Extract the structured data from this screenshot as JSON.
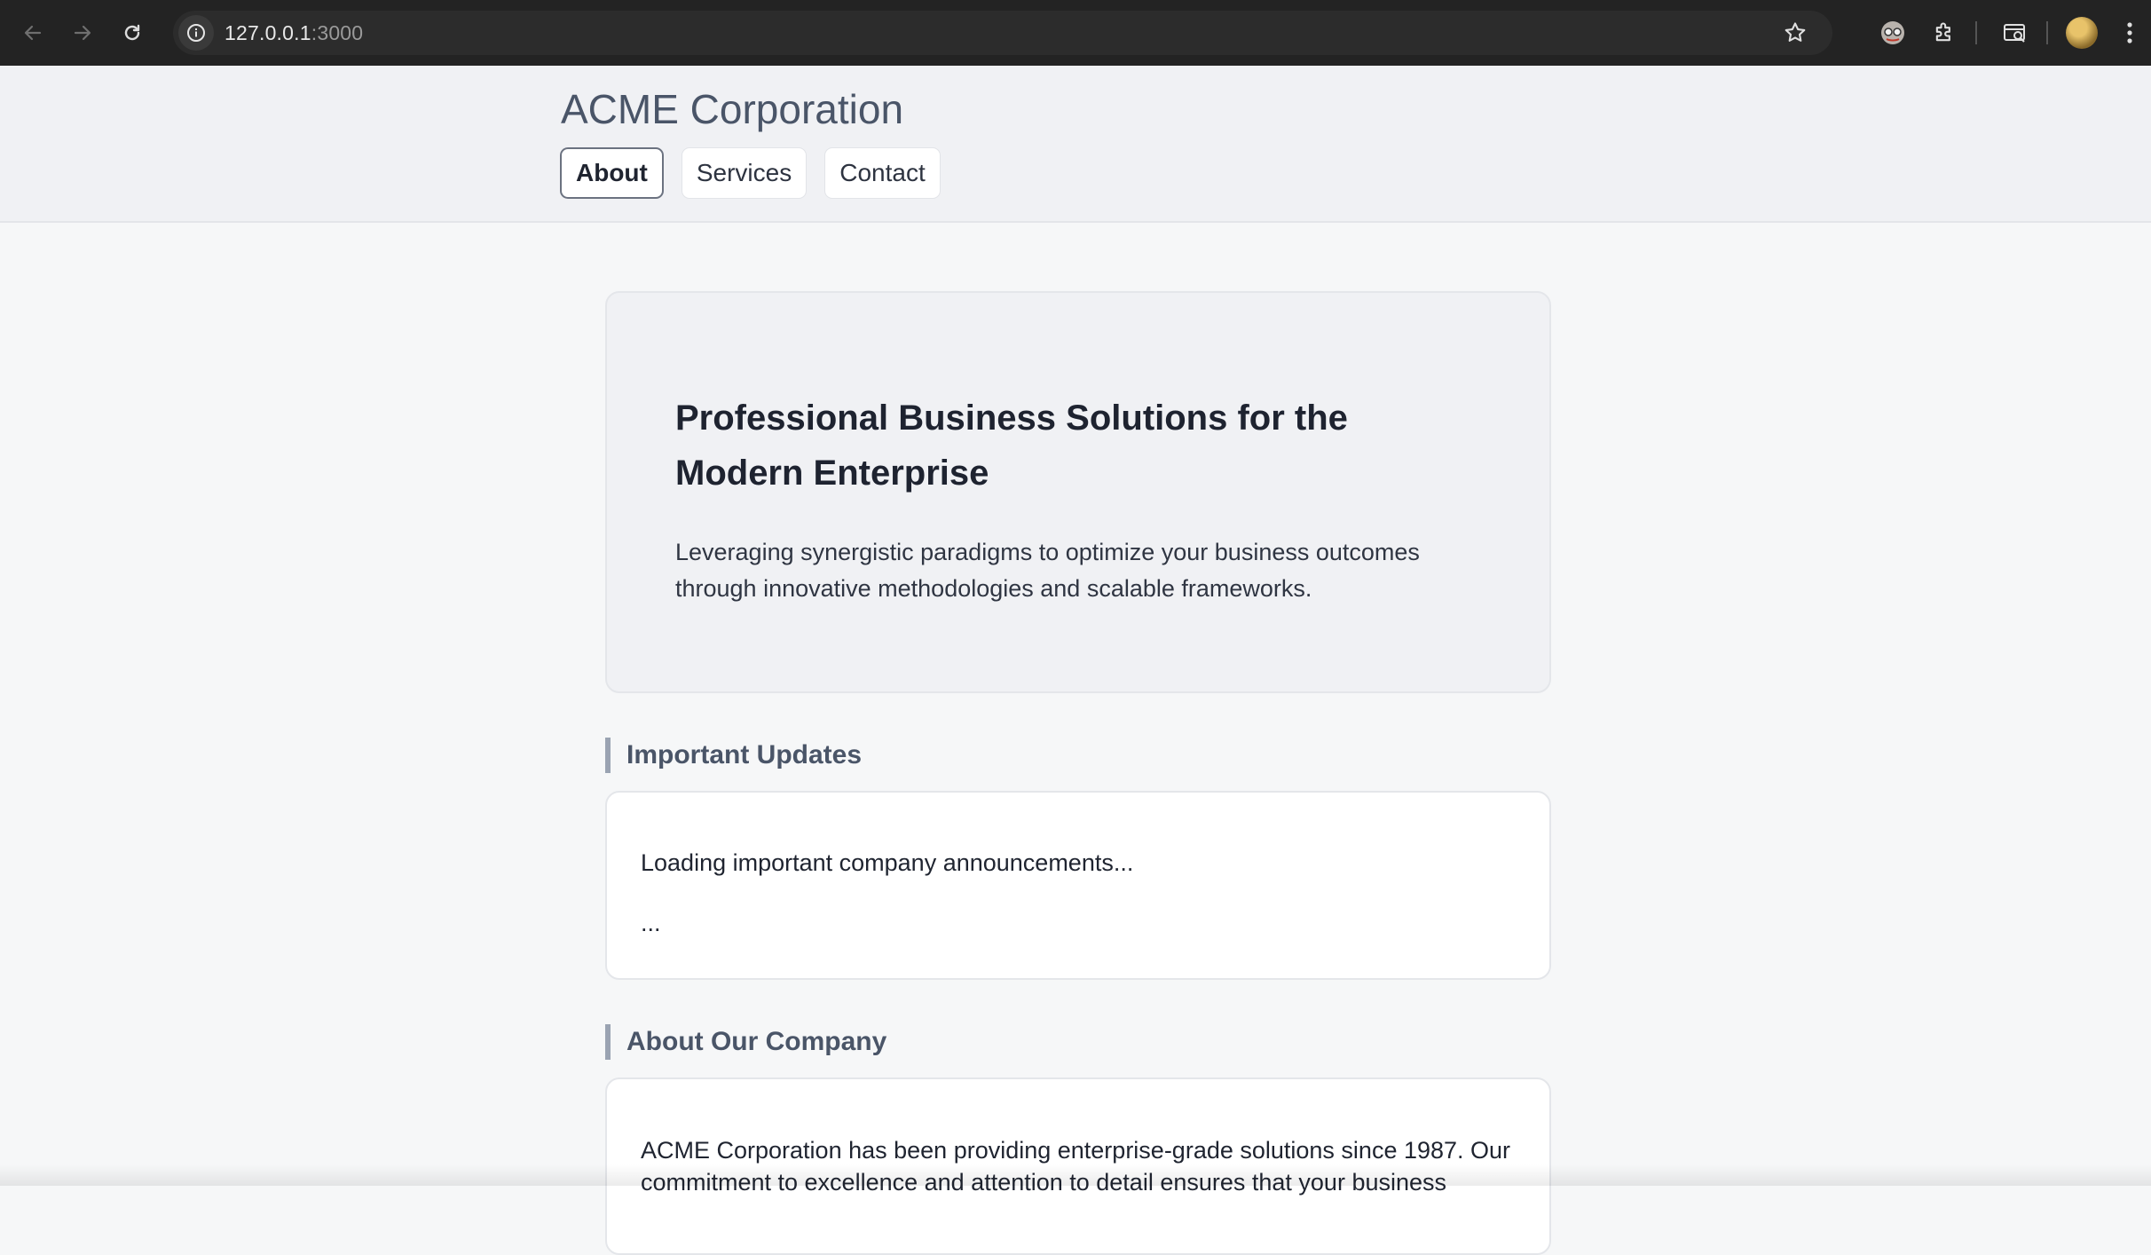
{
  "browser": {
    "url_host": "127.0.0.1",
    "url_port": ":3000",
    "icons": [
      "back-arrow-icon",
      "forward-arrow-icon",
      "reload-icon",
      "site-info-icon",
      "bookmark-star-icon",
      "extension-icon",
      "puzzle-icon",
      "tab-search-icon",
      "profile-avatar",
      "more-vert-icon"
    ]
  },
  "header": {
    "brand": "ACME Corporation",
    "tabs": [
      {
        "label": "About",
        "active": true
      },
      {
        "label": "Services",
        "active": false
      },
      {
        "label": "Contact",
        "active": false
      }
    ]
  },
  "hero": {
    "title": "Professional Business Solutions for the Modern Enterprise",
    "description": "Leveraging synergistic paradigms to optimize your business outcomes through innovative methodologies and scalable frameworks."
  },
  "updates": {
    "title": "Important Updates",
    "loading_text": "Loading important company announcements...",
    "ellipsis": "..."
  },
  "about": {
    "title": "About Our Company",
    "text": "ACME Corporation has been providing enterprise-grade solutions since 1987. Our commitment to excellence and attention to detail ensures that your business"
  },
  "colors": {
    "chrome_bg": "#232323",
    "header_bg": "#f0f1f4",
    "page_bg": "#f6f7f8",
    "accent_bar": "#9aa3b2"
  }
}
